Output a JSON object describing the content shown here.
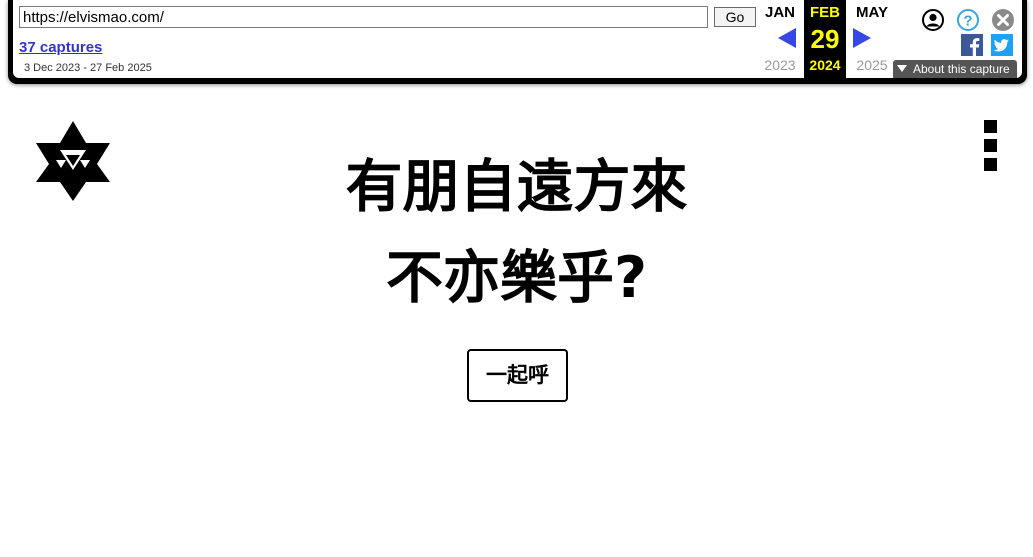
{
  "wayback": {
    "url_value": "https://elvismao.com/",
    "go_label": "Go",
    "captures_label": "37 captures",
    "date_range": "3 Dec 2023 - 27 Feb 2025",
    "calendar": {
      "prev_month": "JAN",
      "current_month": "FEB",
      "next_month": "MAY",
      "current_day": "29",
      "prev_year": "2023",
      "current_year": "2024",
      "next_year": "2025"
    },
    "about_label": "About this capture",
    "icons": [
      "user-icon",
      "help-icon",
      "close-icon",
      "facebook-icon",
      "twitter-icon"
    ],
    "colors": {
      "nav_arrow": "#3548e6",
      "highlight": "#ffff00",
      "link": "#3333cc"
    }
  },
  "site": {
    "headline_line1": "有朋自遠方來",
    "headline_line2": "不亦樂乎?",
    "cta_label": "一起呼",
    "logo_icon": "star-logo-icon",
    "menu_icon": "menu-icon"
  }
}
